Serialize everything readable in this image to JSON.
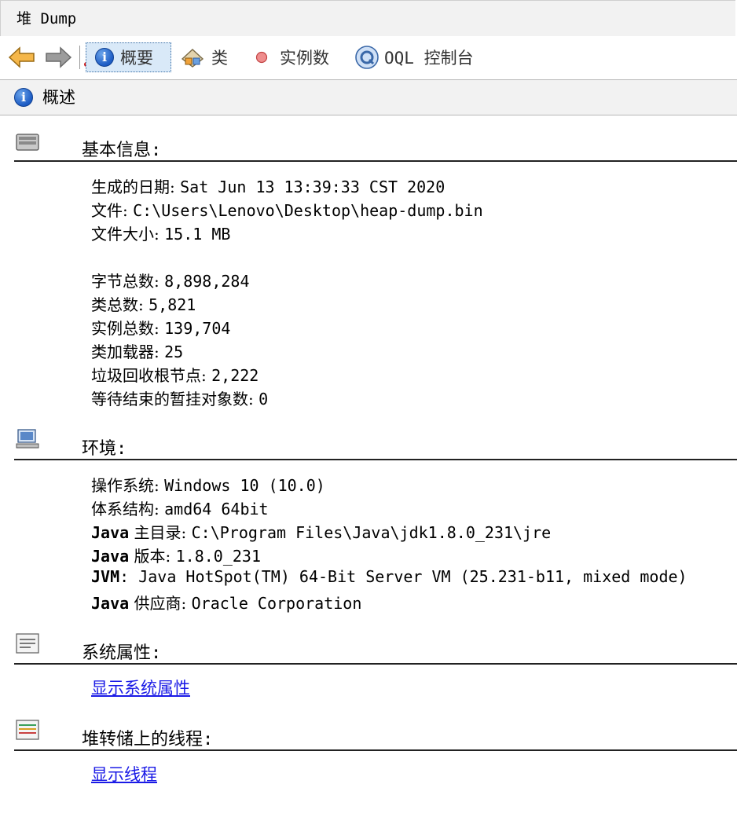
{
  "window": {
    "title": "堆 Dump"
  },
  "toolbar": {
    "summary_label": "概要",
    "classes_label": "类",
    "instances_label": "实例数",
    "oql_label": "OQL 控制台"
  },
  "subheader": {
    "title": "概述"
  },
  "basic": {
    "title": "基本信息:",
    "created_key": "生成的日期: ",
    "created_val": "Sat Jun 13 13:39:33 CST 2020",
    "file_key": "文件: ",
    "file_val": "C:\\Users\\Lenovo\\Desktop\\heap-dump.bin",
    "size_key": "文件大小: ",
    "size_val": "15.1 MB",
    "bytes_key": "字节总数: ",
    "bytes_val": "8,898,284",
    "classes_key": "类总数: ",
    "classes_val": "5,821",
    "instances_key": "实例总数: ",
    "instances_val": "139,704",
    "loaders_key": "类加载器: ",
    "loaders_val": "25",
    "gcroots_key": "垃圾回收根节点: ",
    "gcroots_val": "2,222",
    "pending_key": "等待结束的暂挂对象数: ",
    "pending_val": "0"
  },
  "env": {
    "title": "环境:",
    "os_key": "操作系统: ",
    "os_val": "Windows 10 (10.0)",
    "arch_key": "体系结构: ",
    "arch_val": "amd64 64bit",
    "home_java": "Java",
    "home_key": " 主目录: ",
    "home_val": "C:\\Program Files\\Java\\jdk1.8.0_231\\jre",
    "ver_java": "Java",
    "ver_key": " 版本: ",
    "ver_val": "1.8.0_231",
    "jvm_key": "JVM",
    "jvm_val": ": Java HotSpot(TM) 64-Bit Server VM (25.231-b11, mixed mode)",
    "vendor_java": "Java",
    "vendor_key": " 供应商: ",
    "vendor_val": "Oracle Corporation"
  },
  "sysprops": {
    "title": "系统属性:",
    "link": "显示系统属性"
  },
  "threads": {
    "title": "堆转储上的线程:",
    "link": "显示线程"
  },
  "colors": {
    "link": "#1a1ae6",
    "selected_bg": "#d9e9f8",
    "header_bg": "#f2f2f2"
  }
}
